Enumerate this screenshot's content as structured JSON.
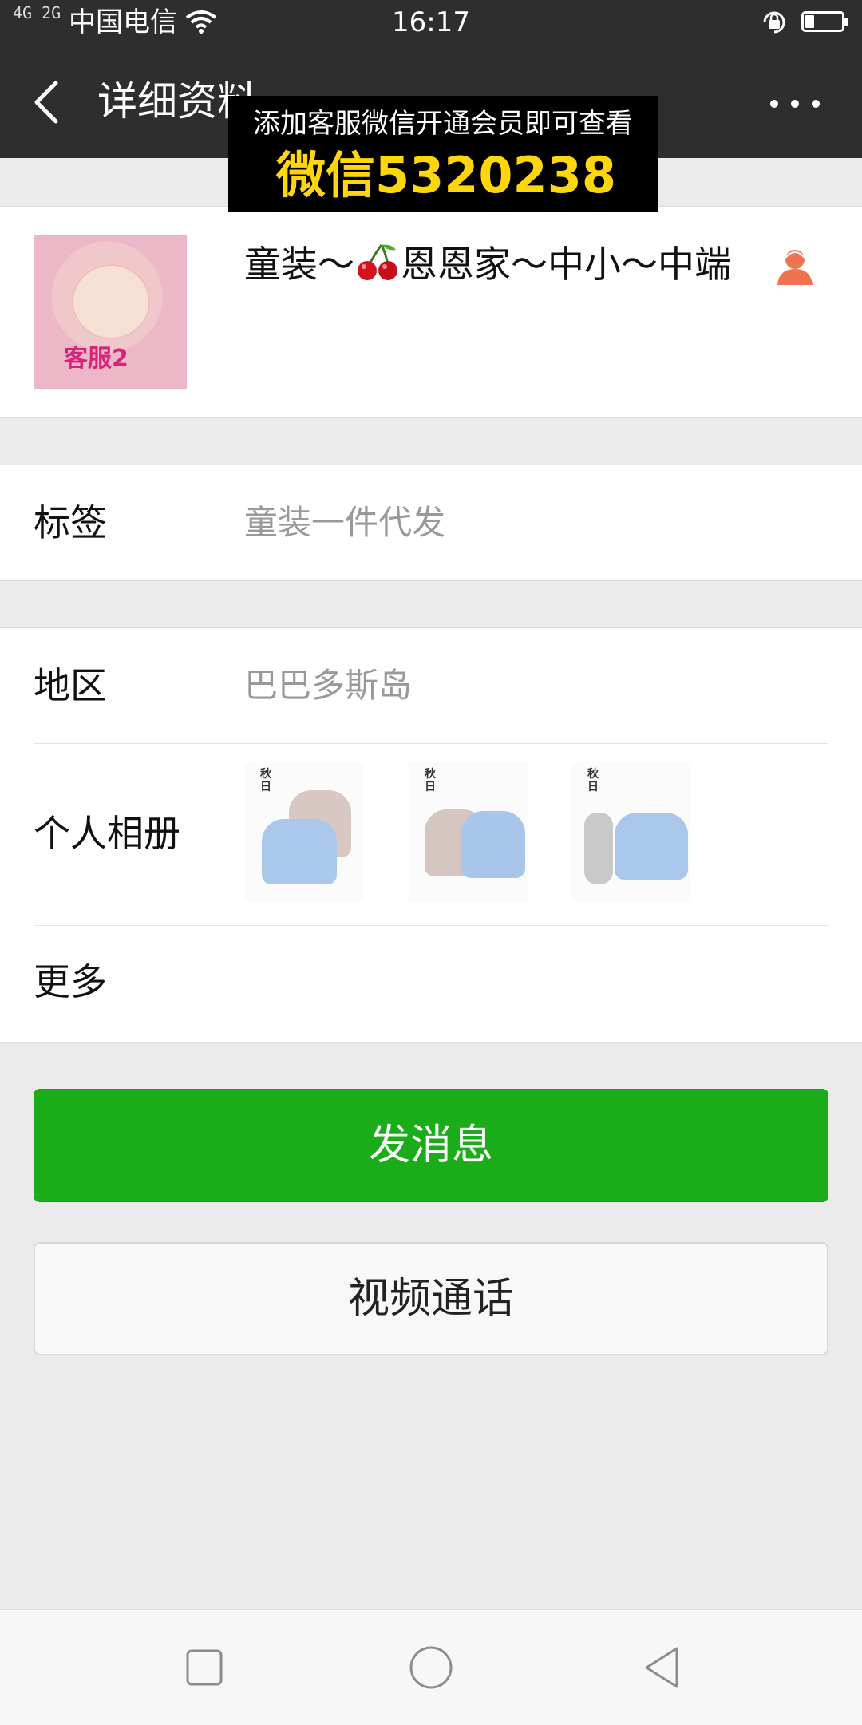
{
  "status_bar": {
    "signal": "4G 2G",
    "carrier": "中国电信",
    "time": "16:17",
    "battery_level": 0.25
  },
  "nav": {
    "title": "详细资料",
    "back_icon": "chevron-left-icon",
    "more_icon": "more-dots-icon"
  },
  "profile": {
    "avatar_badge": "客服2",
    "nickname_part1": "童装～",
    "nickname_emoji": "cherry-icon",
    "nickname_part2": "恩恩家～中小～中端",
    "gender_icon": "female-gender-icon",
    "overlay_line1": "添加客服微信开通会员即可查看",
    "overlay_line2": "微信5320238"
  },
  "tags": {
    "label": "标签",
    "value": "童装一件代发"
  },
  "info": {
    "region_label": "地区",
    "region_value": "巴巴多斯岛",
    "album_label": "个人相册",
    "album_photos": [
      "photo-1",
      "photo-2",
      "photo-3"
    ],
    "more_label": "更多"
  },
  "buttons": {
    "message": "发消息",
    "video_call": "视频通话"
  },
  "system_nav": {
    "recent_icon": "square-icon",
    "home_icon": "circle-icon",
    "back_icon": "triangle-back-icon"
  },
  "colors": {
    "header_bg": "#2e2e2e",
    "accent_green": "#1aad19",
    "overlay_text_yellow": "#ffd60a"
  }
}
